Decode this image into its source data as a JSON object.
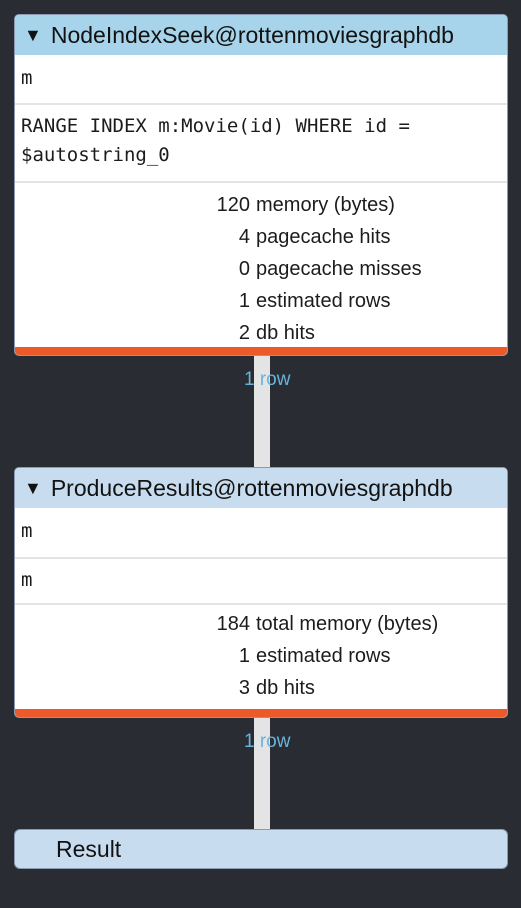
{
  "nodes": [
    {
      "title": "NodeIndexSeek@rottenmoviesgraphdb",
      "identifier": "m",
      "details_line1": "RANGE INDEX m:Movie(id) WHERE id =",
      "details_line2": "$autostring_0",
      "stats": [
        {
          "num": "120",
          "label": "memory (bytes)"
        },
        {
          "num": "4",
          "label": "pagecache hits"
        },
        {
          "num": "0",
          "label": "pagecache misses"
        },
        {
          "num": "1",
          "label": "estimated rows"
        },
        {
          "num": "2",
          "label": "db hits"
        }
      ],
      "rows_out": "1 row"
    },
    {
      "title": "ProduceResults@rottenmoviesgraphdb",
      "identifier": "m",
      "details": "m",
      "stats": [
        {
          "num": "184",
          "label": "total memory (bytes)"
        },
        {
          "num": "1",
          "label": "estimated rows"
        },
        {
          "num": "3",
          "label": "db hits"
        }
      ],
      "rows_out": "1 row"
    }
  ],
  "result": {
    "title": "Result"
  },
  "colors": {
    "background": "#292c33",
    "header_first": "#a7d4ea",
    "header": "#c8dcf0",
    "bar": "#ec5a2a",
    "rows_label": "#68b4dc"
  }
}
